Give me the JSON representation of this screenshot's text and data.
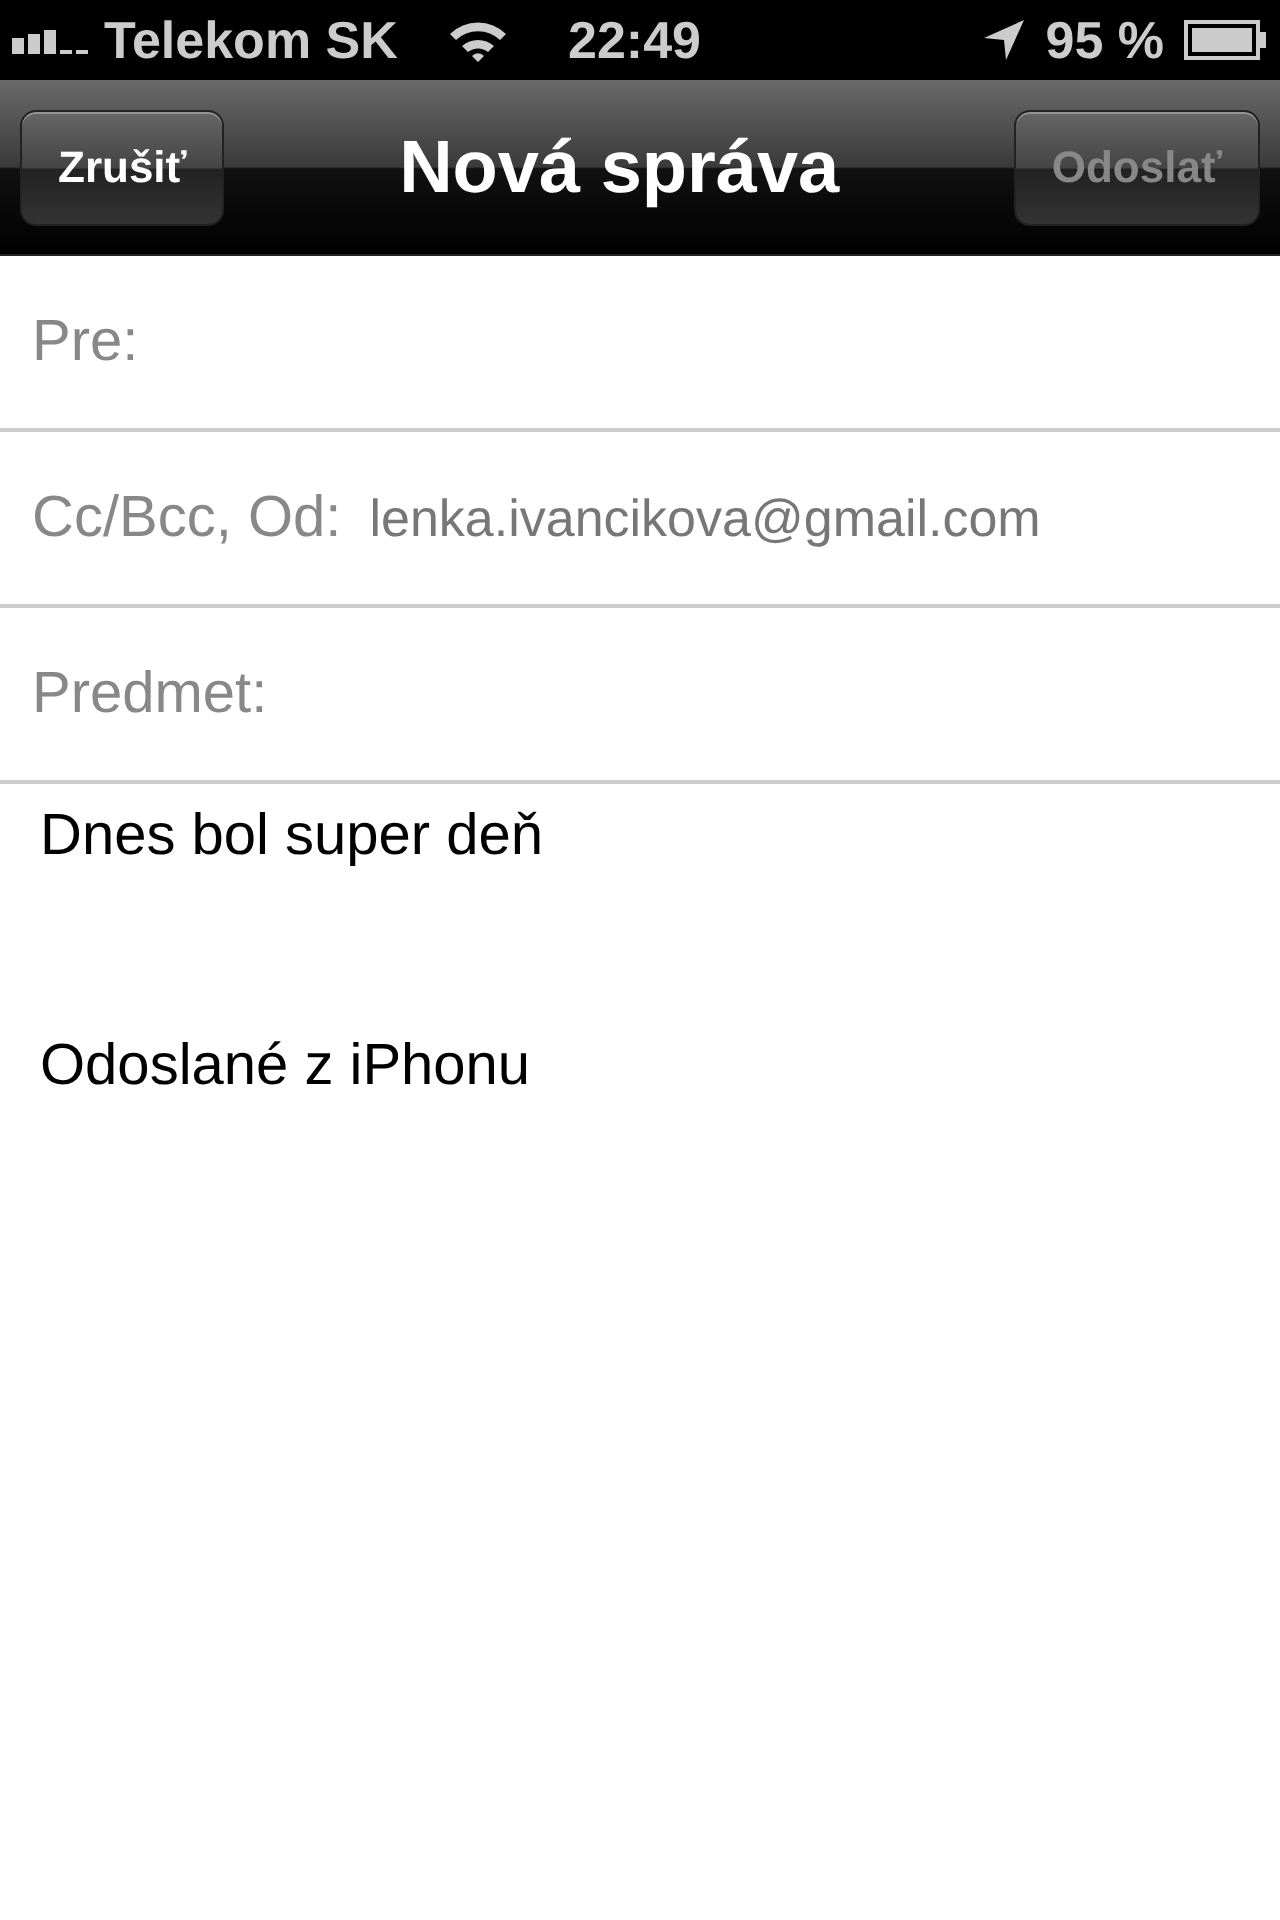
{
  "status_bar": {
    "carrier": "Telekom SK",
    "time": "22:49",
    "battery": "95 %"
  },
  "nav_bar": {
    "title": "Nová správa",
    "cancel_button": {
      "label": "Zrušiť",
      "disabled": false
    },
    "send_button": {
      "label": "Odoslať",
      "disabled": true
    }
  },
  "fields": [
    {
      "label": "Pre:"
    },
    {
      "label": "Cc/Bcc, Od:",
      "value": "lenka.ivancikova@gmail.com"
    },
    {
      "label": "Predmet:"
    }
  ],
  "body": [
    "Dnes bol super deň",
    "Odoslané z iPhonu"
  ]
}
